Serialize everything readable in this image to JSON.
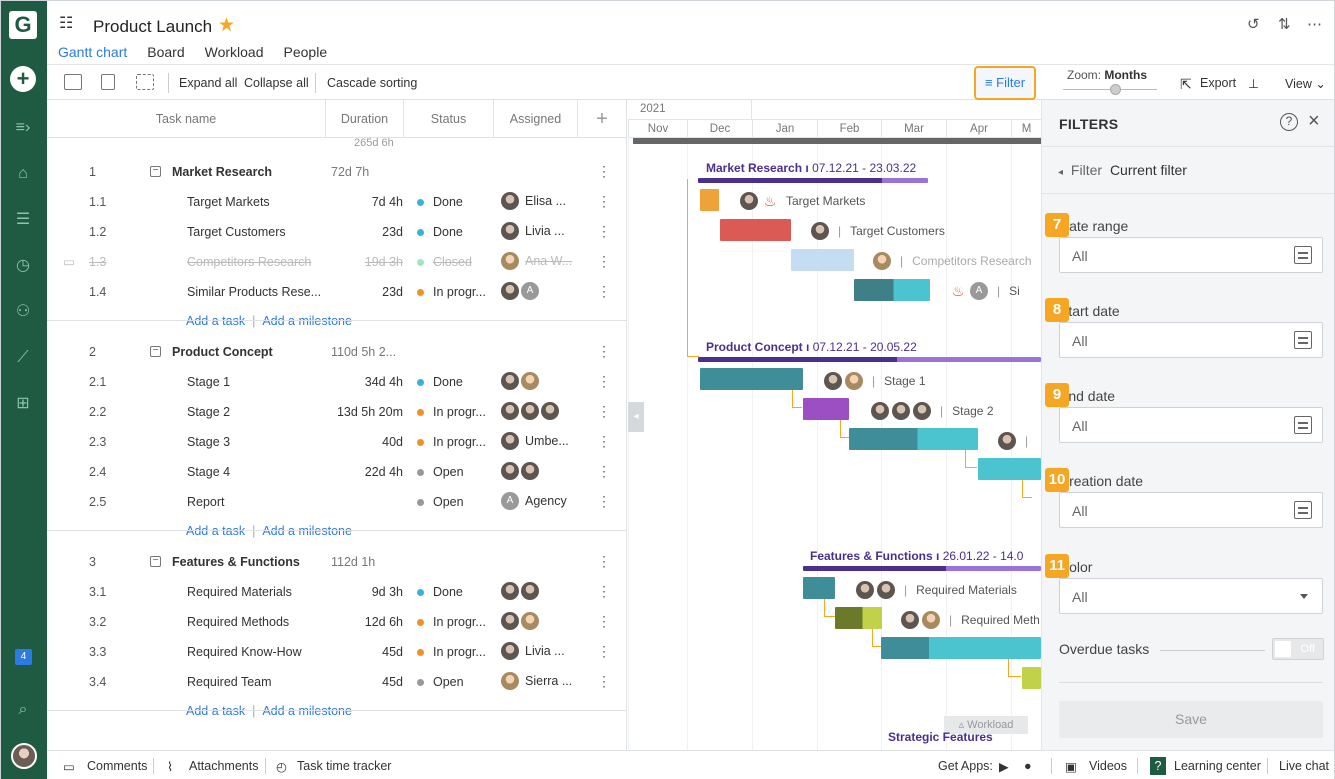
{
  "project": {
    "title": "Product Launch"
  },
  "tabs": [
    "Gantt chart",
    "Board",
    "Workload",
    "People"
  ],
  "toolbar": {
    "expand_all": "Expand all",
    "collapse_all": "Collapse all",
    "cascade_sorting": "Cascade sorting",
    "filter": "Filter",
    "zoom_label": "Zoom:",
    "zoom_value": "Months",
    "export": "Export",
    "view": "View"
  },
  "grid": {
    "columns": [
      "Task name",
      "Duration",
      "Status",
      "Assigned"
    ],
    "total_duration": "265d 6h",
    "add_task": "Add a task",
    "add_milestone": "Add a milestone"
  },
  "rows": [
    {
      "type": "group",
      "num": "1",
      "name": "Market Research",
      "dur": "72d 7h"
    },
    {
      "type": "task",
      "num": "1.1",
      "name": "Target Markets",
      "dur": "7d 4h",
      "status": "Done",
      "status_color": "#3bb0d8",
      "assigned": "Elisa ..."
    },
    {
      "type": "task",
      "num": "1.2",
      "name": "Target Customers",
      "dur": "23d",
      "status": "Done",
      "status_color": "#3bb0d8",
      "assigned": "Livia ..."
    },
    {
      "type": "task",
      "num": "1.3",
      "name": "Competitors Research",
      "dur": "19d 3h",
      "status": "Closed",
      "status_color": "#a6e3c1",
      "assigned": "Ana W...",
      "struck": true
    },
    {
      "type": "task",
      "num": "1.4",
      "name": "Similar Products Rese...",
      "dur": "23d",
      "status": "In progr...",
      "status_color": "#f0902c",
      "assigned": ""
    },
    {
      "type": "add"
    },
    {
      "type": "group",
      "num": "2",
      "name": "Product Concept",
      "dur": "110d 5h 2..."
    },
    {
      "type": "task",
      "num": "2.1",
      "name": "Stage 1",
      "dur": "34d 4h",
      "status": "Done",
      "status_color": "#3bb0d8",
      "assigned": ""
    },
    {
      "type": "task",
      "num": "2.2",
      "name": "Stage 2",
      "dur": "13d 5h 20m",
      "status": "In progr...",
      "status_color": "#f0902c",
      "assigned": ""
    },
    {
      "type": "task",
      "num": "2.3",
      "name": "Stage 3",
      "dur": "40d",
      "status": "In progr...",
      "status_color": "#f0902c",
      "assigned": "Umbe..."
    },
    {
      "type": "task",
      "num": "2.4",
      "name": "Stage 4",
      "dur": "22d 4h",
      "status": "Open",
      "status_color": "#999999",
      "assigned": ""
    },
    {
      "type": "task",
      "num": "2.5",
      "name": "Report",
      "dur": "",
      "status": "Open",
      "status_color": "#999999",
      "assigned": "Agency"
    },
    {
      "type": "add"
    },
    {
      "type": "group",
      "num": "3",
      "name": "Features & Functions",
      "dur": "112d 1h"
    },
    {
      "type": "task",
      "num": "3.1",
      "name": "Required Materials",
      "dur": "9d 3h",
      "status": "Done",
      "status_color": "#3bb0d8",
      "assigned": ""
    },
    {
      "type": "task",
      "num": "3.2",
      "name": "Required Methods",
      "dur": "12d 6h",
      "status": "In progr...",
      "status_color": "#f0902c",
      "assigned": ""
    },
    {
      "type": "task",
      "num": "3.3",
      "name": "Required Know-How",
      "dur": "45d",
      "status": "In progr...",
      "status_color": "#f0902c",
      "assigned": "Livia ..."
    },
    {
      "type": "task",
      "num": "3.4",
      "name": "Required Team",
      "dur": "45d",
      "status": "Open",
      "status_color": "#999999",
      "assigned": "Sierra ..."
    },
    {
      "type": "add"
    }
  ],
  "timeline": {
    "year": "2021",
    "months": [
      "Nov",
      "Dec",
      "Jan",
      "Feb",
      "Mar",
      "Apr",
      "M"
    ],
    "groups": [
      {
        "name": "Market Research",
        "dates": "07.12.21 - 23.03.22"
      },
      {
        "name": "Product Concept",
        "dates": "07.12.21 - 20.05.22"
      },
      {
        "name": "Features & Functions",
        "dates": "26.01.22 - 14.0"
      },
      {
        "name": "Strategic Features",
        "dates": ""
      }
    ],
    "labels": [
      "Target Markets",
      "Target Customers",
      "Competitors Research",
      "Si",
      "Stage 1",
      "Stage 2",
      "Required Materials",
      "Required Meth"
    ],
    "workload": "Workload"
  },
  "filters": {
    "title": "FILTERS",
    "breadcrumb_back": "Filter",
    "breadcrumb_current": "Current filter",
    "fields": [
      {
        "badge": "7",
        "label": "Date range",
        "value": "All"
      },
      {
        "badge": "8",
        "label": "Start date",
        "value": "All"
      },
      {
        "badge": "9",
        "label": "End date",
        "value": "All"
      },
      {
        "badge": "10",
        "label": "Creation date",
        "value": "All"
      },
      {
        "badge": "11",
        "label": "Color",
        "value": "All"
      }
    ],
    "overdue_label": "Overdue tasks",
    "overdue_state": "Off",
    "save": "Save"
  },
  "footer": {
    "comments": "Comments",
    "attachments": "Attachments",
    "time_tracker": "Task time tracker",
    "get_apps": "Get Apps:",
    "videos": "Videos",
    "learning_center": "Learning center",
    "live_chat": "Live chat"
  },
  "notifications_count": "4"
}
